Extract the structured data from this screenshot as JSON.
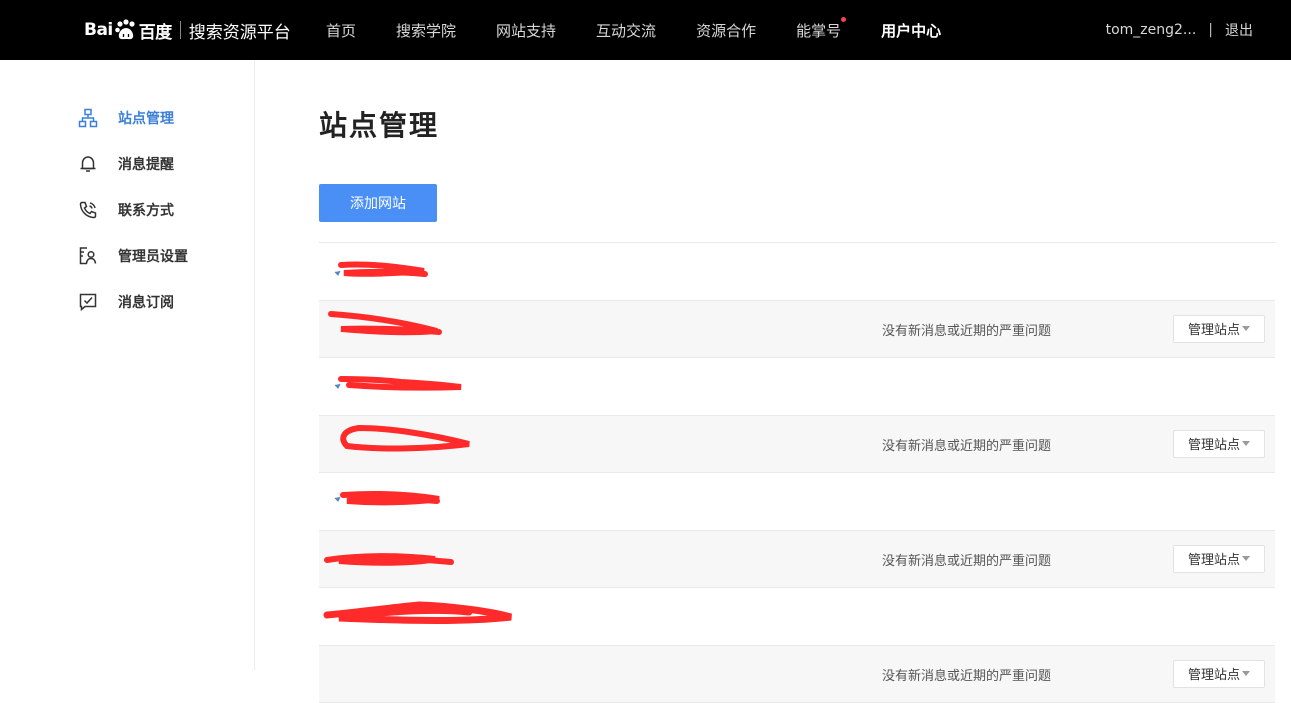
{
  "header": {
    "logo_brand_left": "Bai",
    "logo_brand_right": "百度",
    "logo_sub": "搜索资源平台",
    "nav": [
      {
        "label": "首页",
        "active": false,
        "dot": false
      },
      {
        "label": "搜索学院",
        "active": false,
        "dot": false
      },
      {
        "label": "网站支持",
        "active": false,
        "dot": false
      },
      {
        "label": "互动交流",
        "active": false,
        "dot": false
      },
      {
        "label": "资源合作",
        "active": false,
        "dot": false
      },
      {
        "label": "能掌号",
        "active": false,
        "dot": true
      },
      {
        "label": "用户中心",
        "active": true,
        "dot": false
      }
    ],
    "username": "tom_zeng2...",
    "separator": "|",
    "logout": "退出"
  },
  "sidebar": {
    "items": [
      {
        "label": "站点管理",
        "icon": "sitemap-icon",
        "active": true
      },
      {
        "label": "消息提醒",
        "icon": "bell-icon",
        "active": false
      },
      {
        "label": "联系方式",
        "icon": "phone-icon",
        "active": false
      },
      {
        "label": "管理员设置",
        "icon": "admin-user-icon",
        "active": false
      },
      {
        "label": "消息订阅",
        "icon": "message-check-icon",
        "active": false
      }
    ]
  },
  "main": {
    "title": "站点管理",
    "add_button": "添加网站",
    "sites": [
      {
        "status": "",
        "manage": ""
      },
      {
        "status": "没有新消息或近期的严重问题",
        "manage": "管理站点"
      },
      {
        "status": "",
        "manage": ""
      },
      {
        "status": "没有新消息或近期的严重问题",
        "manage": "管理站点"
      },
      {
        "status": "",
        "manage": ""
      },
      {
        "status": "没有新消息或近期的严重问题",
        "manage": "管理站点"
      },
      {
        "status": "",
        "manage": ""
      },
      {
        "status": "没有新消息或近期的严重问题",
        "manage": "管理站点"
      }
    ]
  },
  "colors": {
    "accent": "#4a8ff6",
    "active_sidebar": "#3c7fd6",
    "redaction": "#ff2a2a",
    "topbar": "#000000"
  }
}
